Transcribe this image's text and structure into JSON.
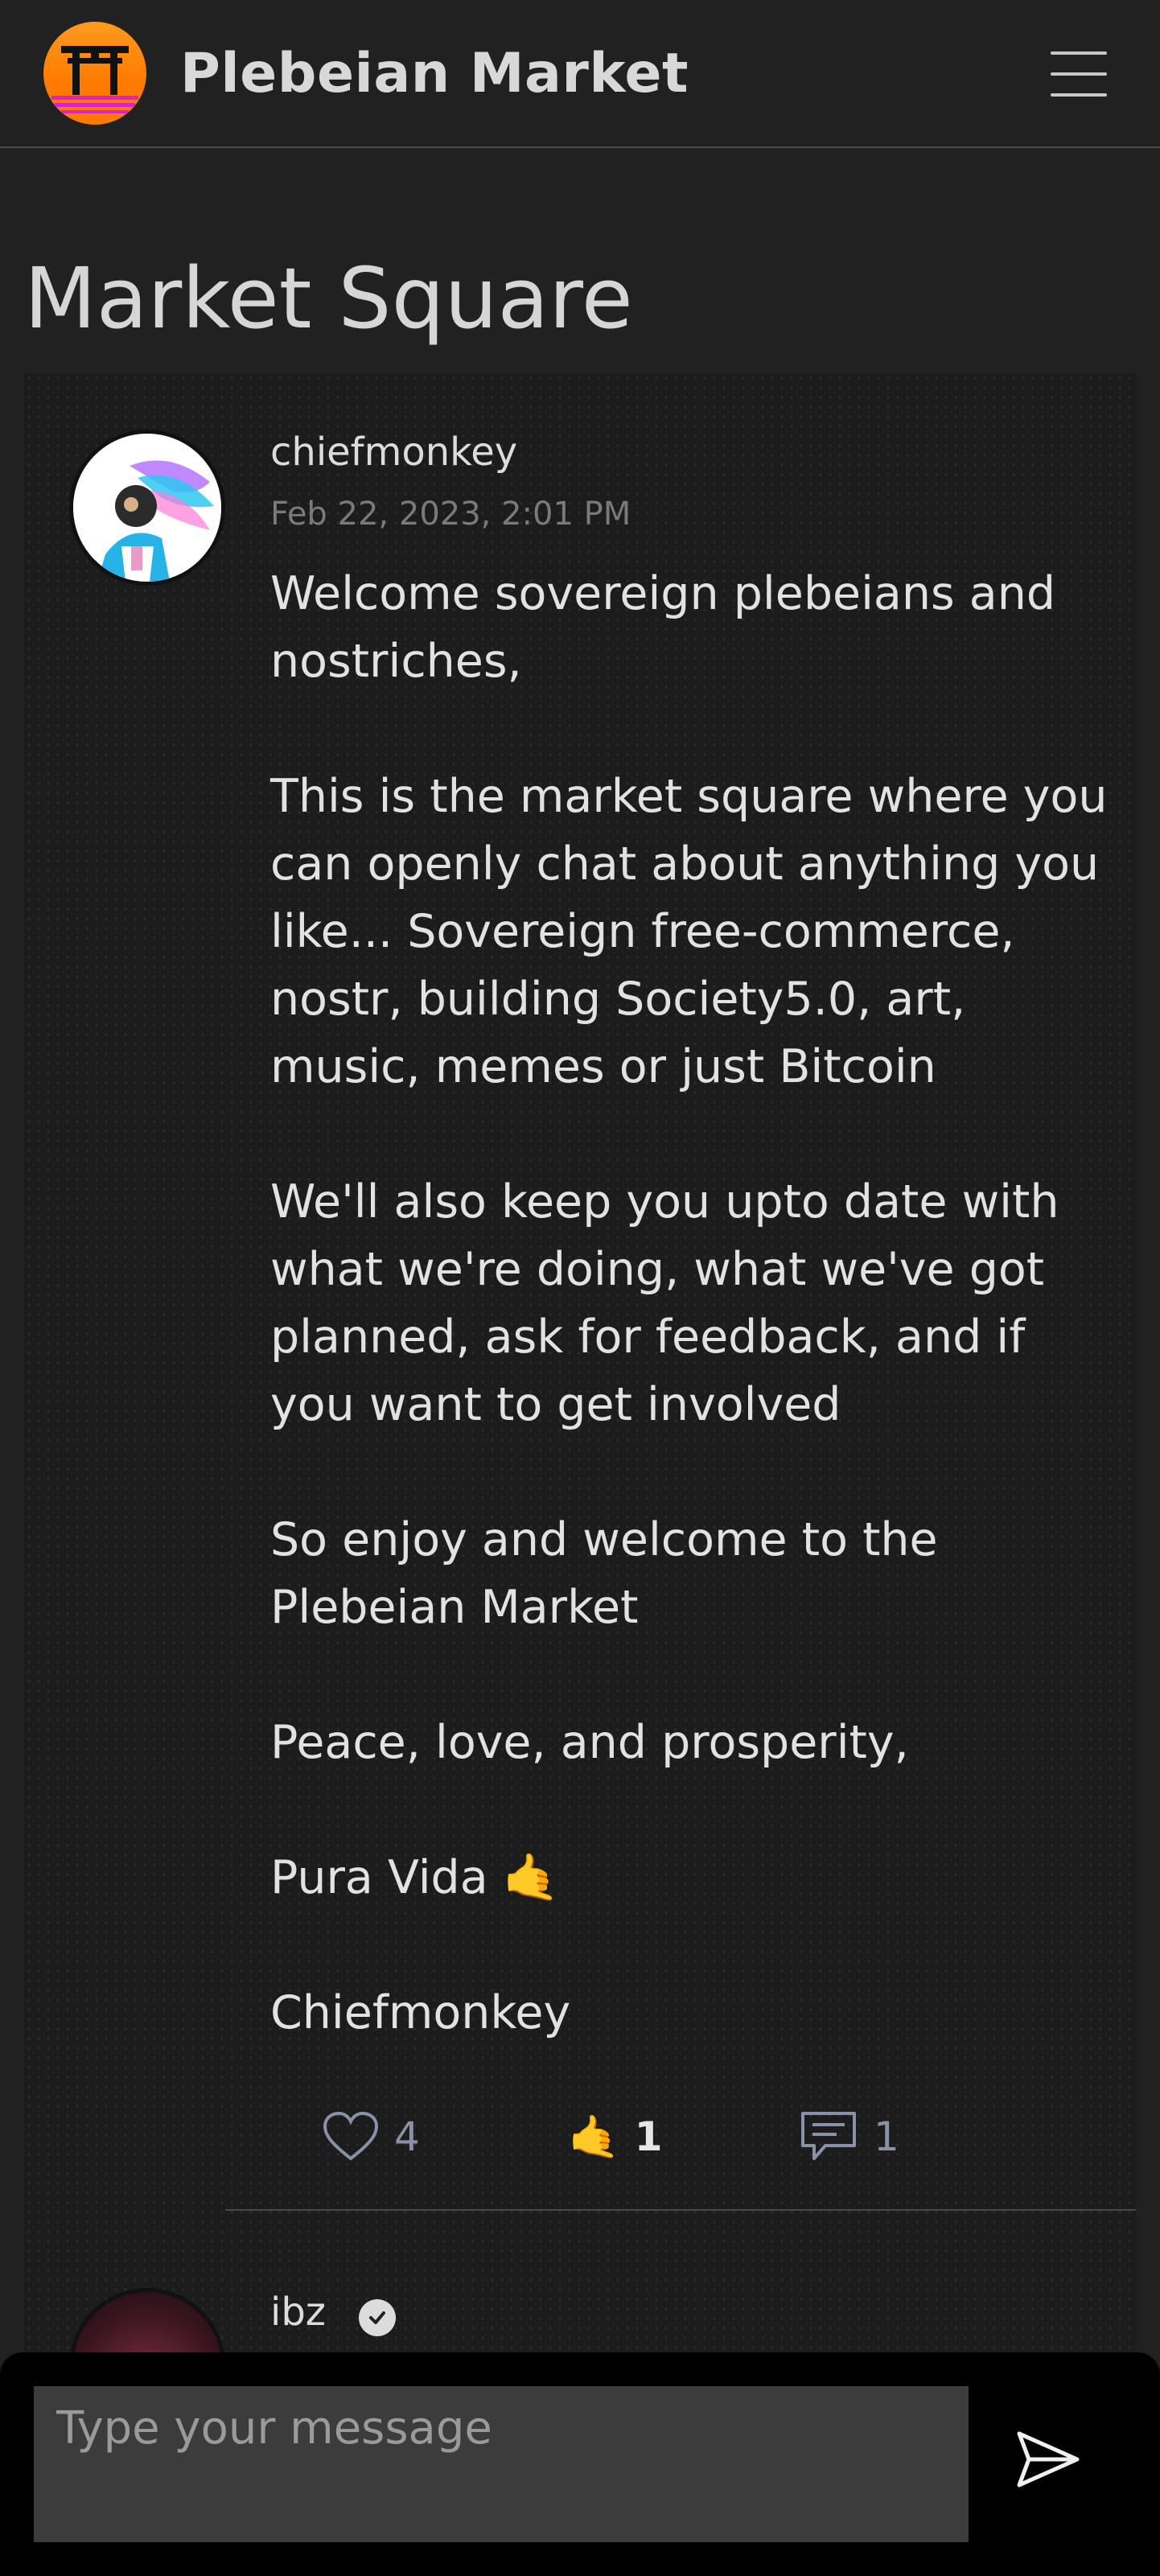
{
  "header": {
    "brand": "Plebeian Market",
    "logo_icon": "torii-gate-icon",
    "menu_icon": "hamburger-menu-icon"
  },
  "page_title": "Market Square",
  "posts": [
    {
      "author": "chiefmonkey",
      "timestamp": "Feb 22, 2023, 2:01 PM",
      "paragraphs": [
        "Welcome sovereign plebeians and nostriches,",
        "This is the market square where you can openly chat about anything you like... Sovereign free-commerce, nostr, building Society5.0, art, music, memes or just Bitcoin",
        "We'll also keep you upto date with what we're doing, what we've got planned, ask for feedback, and if you want to get involved",
        "So enjoy and welcome to the Plebeian Market",
        "Peace, love, and prosperity,",
        "Pura Vida 🤙",
        "Chiefmonkey"
      ],
      "reactions": {
        "likes": "4",
        "shaka_emoji": "🤙",
        "shaka_count": "1",
        "replies": "1"
      }
    },
    {
      "author": "ibz",
      "verified_icon": "verified-check-icon"
    }
  ],
  "composer": {
    "placeholder": "Type your message",
    "send_icon": "send-arrow-icon"
  },
  "colors": {
    "background": "#212121",
    "logo_orange": "#ff7a00",
    "logo_magenta": "#e020c8",
    "composer_bg": "#000000",
    "input_bg": "#3c3c3c",
    "reaction_count": "#8a90a8"
  }
}
